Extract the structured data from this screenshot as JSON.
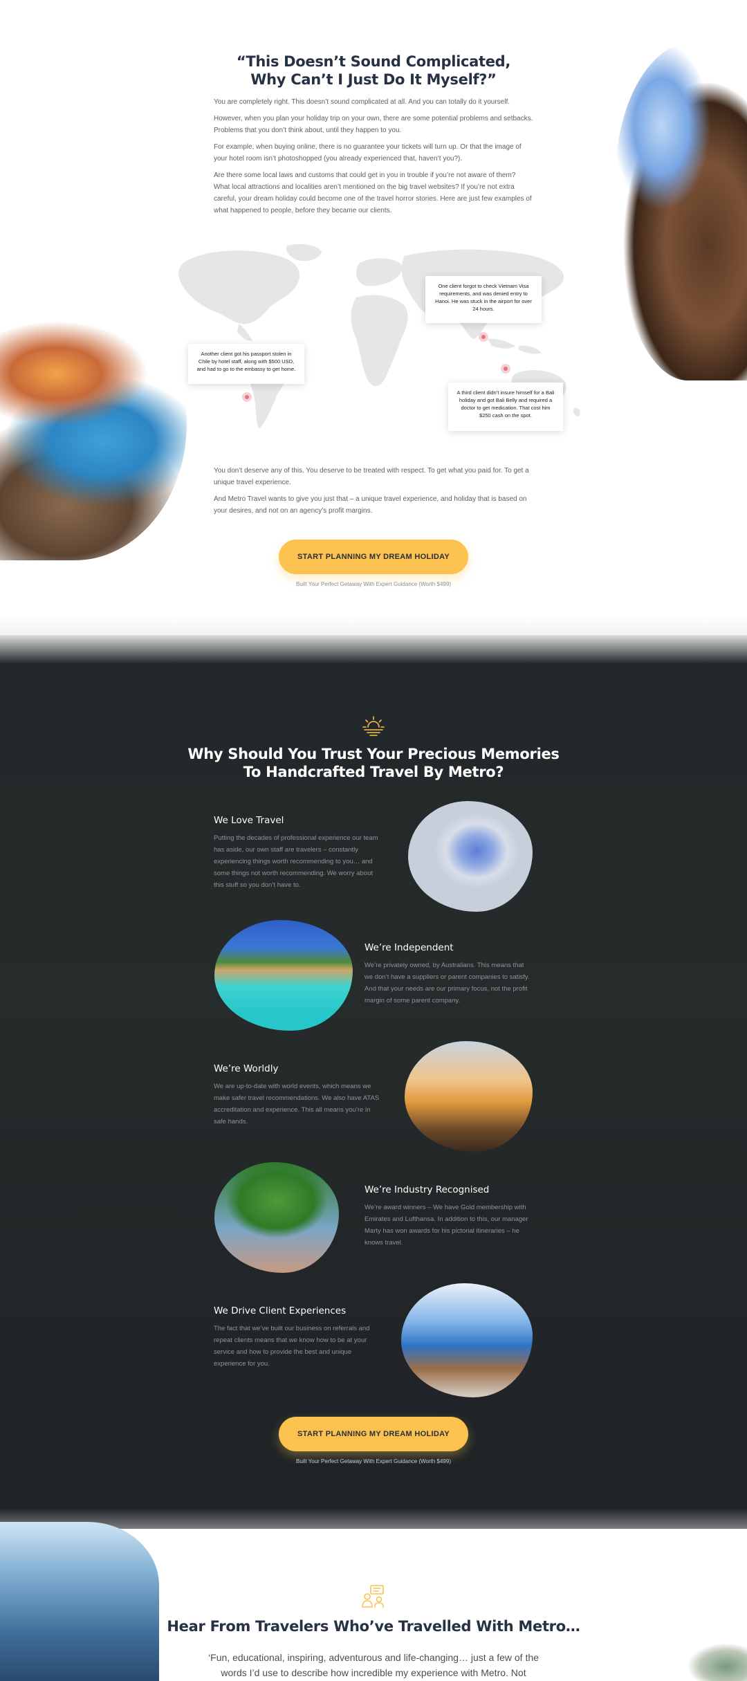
{
  "section1": {
    "heading_line1": "“This Doesn’t Sound Complicated,",
    "heading_line2": "Why Can’t I Just Do It Myself?”",
    "paragraphs": [
      "You are completely right. This doesn’t sound complicated at all. And you can totally do it yourself.",
      "However, when you plan your holiday trip on your own, there are some potential problems and setbacks. Problems that you don’t think about, until they happen to you.",
      "For example, when buying online, there is no guarantee your tickets will turn up. Or that the image of your hotel room isn’t photoshopped (you already experienced that, haven’t you?).",
      "Are there some local laws and customs that could get in you in trouble if you’re not aware of them? What local attractions and localities aren’t mentioned on the big travel websites? If you’re not extra careful, your dream holiday could become one of the travel horror stories. Here are just few examples of what happened to people, before they became our clients."
    ],
    "callouts": {
      "vietnam": "One client forgot to check Vietnam Visa requirements, and was denied entry to Hanoi. He was stuck in the airport for over 24 hours.",
      "chile": "Another client got his passport stolen in Chile by hotel staff, along with $500 USD, and had to go to the embassy to get home.",
      "bali": "A third client didn’t insure himself for a Bali holiday and got Bali Belly and required a doctor to get medication. That cost him $250 cash on the spot."
    },
    "closing": [
      "You don’t deserve any of this. You deserve to be treated with respect. To get what you paid for. To get a unique travel experience.",
      "And Metro Travel wants to give you just that – a unique travel experience, and holiday that is based on your desires, and not on an agency’s profit margins."
    ],
    "cta_label": "START PLANNING MY DREAM HOLIDAY",
    "cta_sub": "Built Your Perfect Getaway With Expert Guidance (Worth $499)"
  },
  "section2": {
    "heading_line1": "Why Should You Trust Your Precious Memories",
    "heading_line2": "To Handcrafted Travel By Metro?",
    "features": [
      {
        "title": "We Love Travel",
        "text": "Putting the decades of professional experience our team has aside, our own staff are travelers – constantly experiencing things worth recommending to  you… and some things not worth recommending. We worry about this stuff so you don’t have to."
      },
      {
        "title": "We’re Independent",
        "text": "We’re privately owned, by Australians. This means that we don’t have a suppliers or parent companies to satisfy. And that your needs are our primary focus, not the profit margin of some parent company."
      },
      {
        "title": "We’re Worldly",
        "text": "We are up-to-date with world events, which means we make safer travel recommendations. We also have ATAS accreditation and experience. This all means you’re in safe hands."
      },
      {
        "title": "We’re Industry Recognised",
        "text": "We’re award winners – We have Gold membership with Emirates and Lufthansa. In addition to this, our manager Marty has won awards for his pictorial itineraries – he knows travel."
      },
      {
        "title": "We Drive Client Experiences",
        "text": "The fact that we’ve built our business on referrals and repeat clients means that we know how to be at your service and how to provide the best and unique experience for you."
      }
    ],
    "cta_label": "START PLANNING MY DREAM HOLIDAY",
    "cta_sub": "Built Your Perfect Getaway With Expert Guidance (Worth $499)"
  },
  "section3": {
    "heading": "Hear From Travelers Who’ve Travelled With Metro…",
    "quote": "‘Fun, educational, inspiring, adventurous and life-changing… just a few of the words I’d use to describe how incredible my experience with Metro. Not"
  },
  "colors": {
    "accent": "#fcc24f",
    "heading": "#263143",
    "dark_bg": "#232829",
    "pin": "#e7717f"
  },
  "icons": {
    "sun": "sunset-icon",
    "team": "travelers-icon"
  }
}
